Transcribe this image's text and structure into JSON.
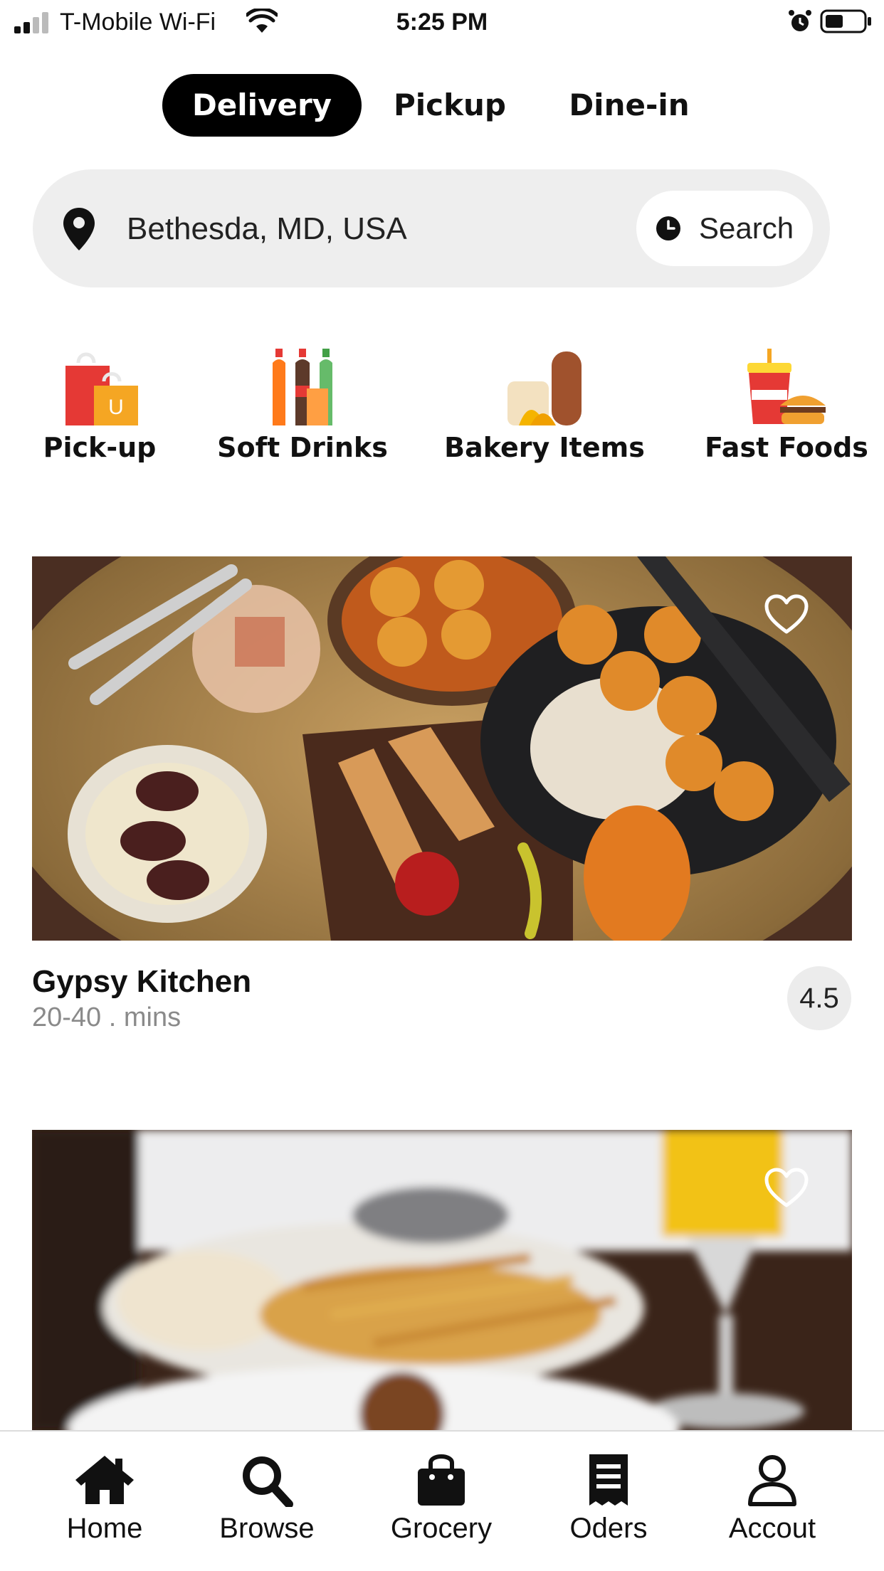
{
  "status_bar": {
    "carrier": "T-Mobile Wi-Fi",
    "time": "5:25 PM",
    "icons": [
      "cellular-signal-icon",
      "wifi-icon",
      "alarm-icon",
      "battery-icon"
    ]
  },
  "mode_tabs": [
    {
      "label": "Delivery",
      "active": true
    },
    {
      "label": "Pickup",
      "active": false
    },
    {
      "label": "Dine-in",
      "active": false
    }
  ],
  "search_bar": {
    "location": "Bethesda, MD, USA",
    "button_label": "Search",
    "icons": [
      "map-pin-icon",
      "clock-icon"
    ]
  },
  "categories": [
    {
      "label": "Pick-up",
      "icon": "shopping-bags-icon"
    },
    {
      "label": "Soft Drinks",
      "icon": "soda-bottles-icon"
    },
    {
      "label": "Bakery Items",
      "icon": "bread-icon"
    },
    {
      "label": "Fast Foods",
      "icon": "burger-drink-icon"
    }
  ],
  "restaurants": [
    {
      "name": "Gypsy Kitchen",
      "time": "20-40 . mins",
      "rating": "4.5"
    },
    {
      "name": "",
      "time": "",
      "rating": ""
    }
  ],
  "bottom_nav": [
    {
      "label": "Home",
      "icon": "home-icon"
    },
    {
      "label": "Browse",
      "icon": "search-icon"
    },
    {
      "label": "Grocery",
      "icon": "shopping-bag-icon"
    },
    {
      "label": "Oders",
      "icon": "receipt-icon"
    },
    {
      "label": "Accout",
      "icon": "user-icon"
    }
  ],
  "colors": {
    "primary": "#000000",
    "search_bar_bg": "#eeeeee",
    "muted_text": "#8a8a8a",
    "rating_bg": "#ececec"
  }
}
